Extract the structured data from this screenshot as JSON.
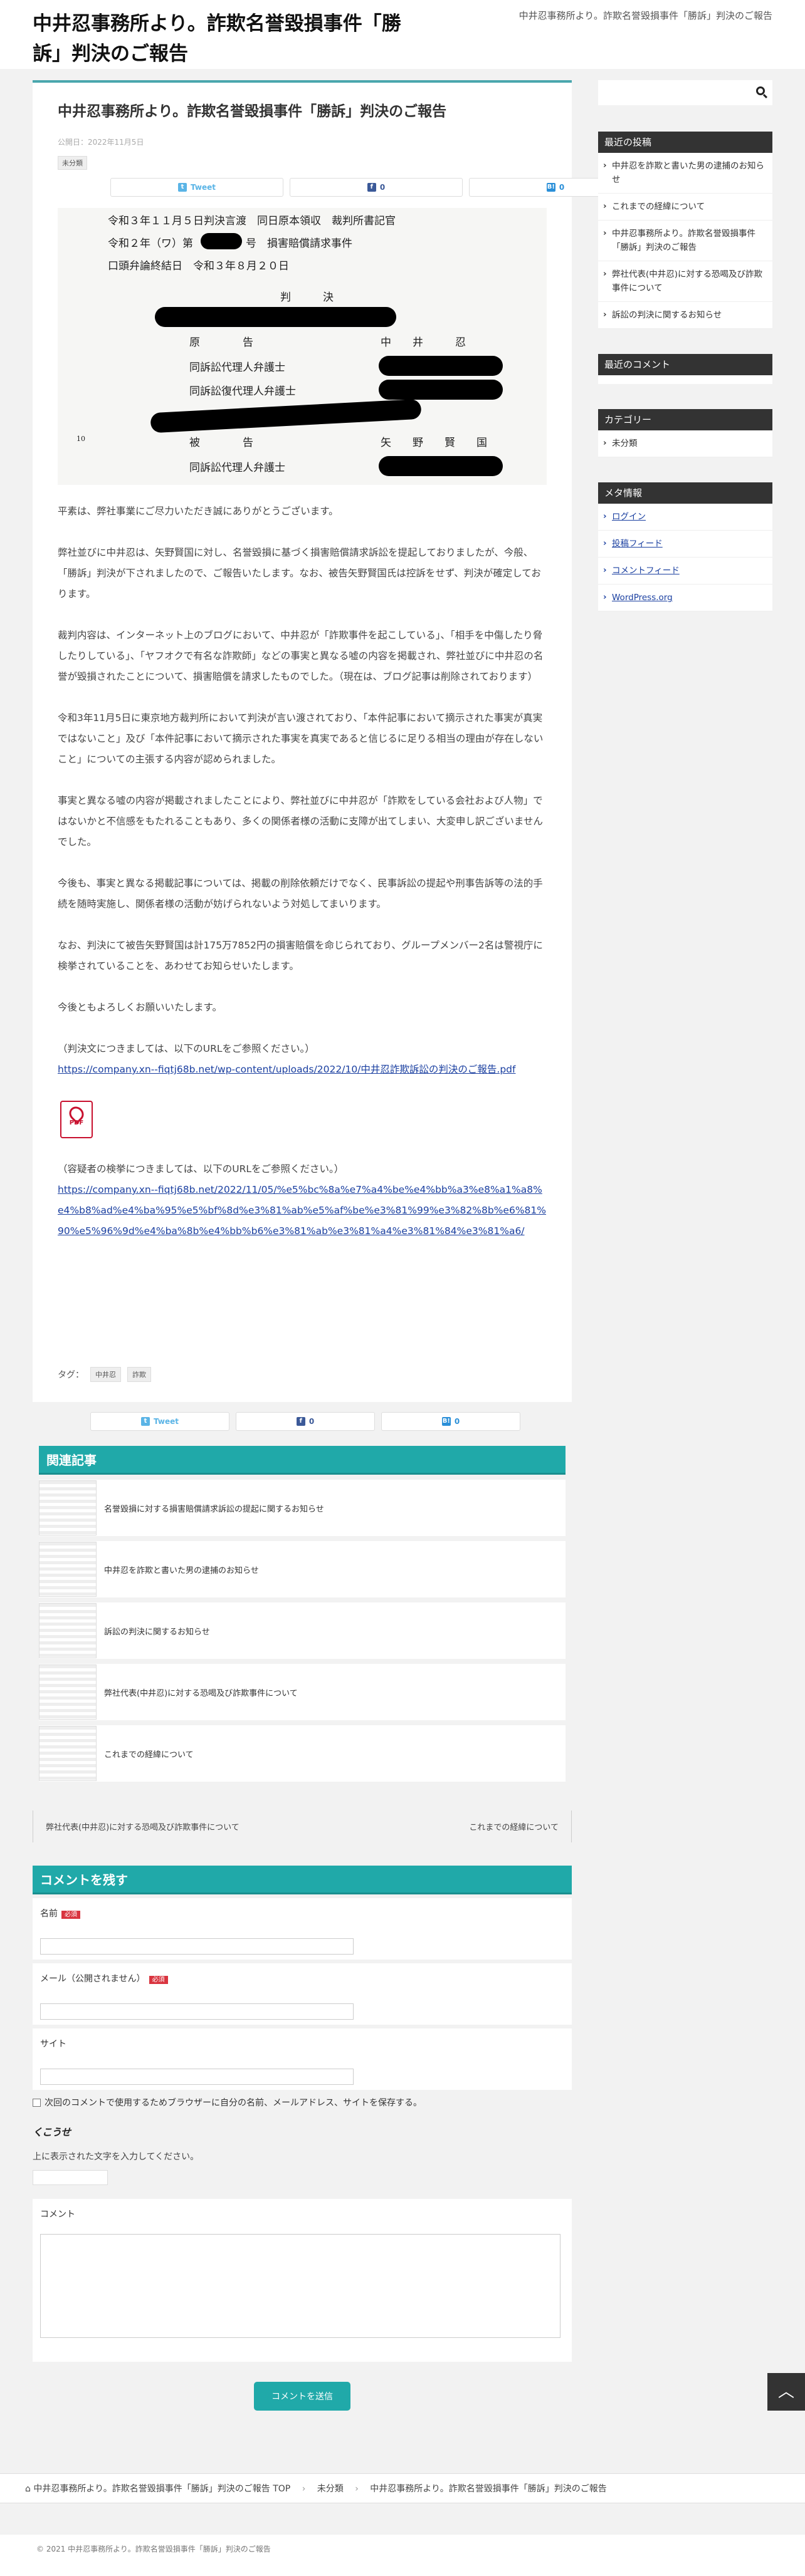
{
  "header": {
    "site_title": "中井忍事務所より。詐欺名誉毀損事件「勝訴」判決のご報告",
    "site_desc": "中井忍事務所より。詐欺名誉毀損事件「勝訴」判決のご報告"
  },
  "post": {
    "title": "中井忍事務所より。詐欺名誉毀損事件「勝訴」判決のご報告",
    "date": "公開日：2022年11月5日",
    "category": "未分類",
    "share": {
      "tweet": "Tweet",
      "fb": "0",
      "hatena": "0"
    },
    "document": {
      "line1": "令和３年１１月５日判決言渡　同日原本領収　裁判所書記官",
      "line2a": "令和２年（ワ）第",
      "line2b": "号　損害賠償請求事件",
      "line3": "口頭弁論終結日　令和３年８月２０日",
      "hanketsu": "判　　　決",
      "genkoku": "原　　　　告",
      "genkoku_name": "中　　井　　　忍",
      "dairi1": "同訴訟代理人弁護士",
      "fukudairi": "同訴訟復代理人弁護士",
      "hikoku": "被　　　　告",
      "hikoku_name": "矢　　野　　賢　　国",
      "dairi2": "同訴訟代理人弁護士",
      "line_no_10": "10"
    },
    "paragraphs": [
      "平素は、弊社事業にご尽力いただき誠にありがとうございます。",
      "弊社並びに中井忍は、矢野賢国に対し、名誉毀損に基づく損害賠償請求訴訟を提起しておりましたが、今般、「勝訴」判決が下されましたので、ご報告いたします。なお、被告矢野賢国氏は控訴をせず、判決が確定しております。",
      "裁判内容は、インターネット上のブログにおいて、中井忍が「詐欺事件を起こしている」、「相手を中傷したり脅したりしている」、「ヤフオクで有名な詐欺師」などの事実と異なる嘘の内容を掲載され、弊社並びに中井忍の名誉が毀損されたことについて、損害賠償を請求したものでした。（現在は、ブログ記事は削除されております）",
      "令和3年11月5日に東京地方裁判所において判決が言い渡されており、「本件記事において摘示された事実が真実ではないこと」及び「本件記事において摘示された事実を真実であると信じるに足りる相当の理由が存在しないこと」についての主張する内容が認められました。",
      "事実と異なる嘘の内容が掲載されましたことにより、弊社並びに中井忍が「詐欺をしている会社および人物」ではないかと不信感をもたれることもあり、多くの関係者様の活動に支障が出てしまい、大変申し訳ございませんでした。",
      "今後も、事実と異なる掲載記事については、掲載の削除依頼だけでなく、民事訴訟の提起や刑事告訴等の法的手続を随時実施し、関係者様の活動が妨げられないよう対処してまいります。",
      "なお、判決にて被告矢野賢国は計175万7852円の損害賠償を命じられており、グループメンバー2名は警視庁に検挙されていることを、あわせてお知らせいたします。",
      "今後ともよろしくお願いいたします。"
    ],
    "ruling_note": "（判決文につきましては、以下のURLをご参照ください。）",
    "ruling_link": "https://company.xn--fiqtj68b.net/wp-content/uploads/2022/10/中井忍詐欺訴訟の判決のご報告.pdf",
    "pdf_label": "PDF",
    "arrest_note": "（容疑者の検挙につきましては、以下のURLをご参照ください。）",
    "arrest_link": "https://company.xn--fiqtj68b.net/2022/11/05/%e5%bc%8a%e7%a4%be%e4%bb%a3%e8%a1%a8%e4%b8%ad%e4%ba%95%e5%bf%8d%e3%81%ab%e5%af%be%e3%81%99%e3%82%8b%e6%81%90%e5%96%9d%e4%ba%8b%e4%bb%b6%e3%81%ab%e3%81%a4%e3%81%84%e3%81%a6/",
    "tags_label": "タグ：",
    "tags": [
      "中井忍",
      "詐欺"
    ]
  },
  "related": {
    "heading": "関連記事",
    "items": [
      "名誉毀損に対する損害賠償請求訴訟の提起に関するお知らせ",
      "中井忍を詐欺と書いた男の逮捕のお知らせ",
      "訴訟の判決に関するお知らせ",
      "弊社代表(中井忍)に対する恐喝及び詐欺事件について",
      "これまでの経緯について"
    ]
  },
  "pager": {
    "prev": "弊社代表(中井忍)に対する恐喝及び詐欺事件について",
    "next": "これまでの経緯について"
  },
  "comment_form": {
    "heading": "コメントを残す",
    "name_label": "名前",
    "email_label": "メール（公開されません）",
    "required": "必須",
    "site_label": "サイト",
    "save_label": "次回のコメントで使用するためブラウザーに自分の名前、メールアドレス、サイトを保存する。",
    "captcha_text": "くこうせ",
    "captcha_label": "上に表示された文字を入力してください。",
    "comment_label": "コメント",
    "submit_label": "コメントを送信"
  },
  "sidebar": {
    "recent_posts_heading": "最近の投稿",
    "recent_posts": [
      "中井忍を詐欺と書いた男の逮捕のお知らせ",
      "これまでの経緯について",
      "中井忍事務所より。詐欺名誉毀損事件「勝訴」判決のご報告",
      "弊社代表(中井忍)に対する恐喝及び詐欺事件について",
      "訴訟の判決に関するお知らせ"
    ],
    "recent_comments_heading": "最近のコメント",
    "categories_heading": "カテゴリー",
    "categories": [
      "未分類"
    ],
    "meta_heading": "メタ情報",
    "meta": [
      "ログイン",
      "投稿フィード",
      "コメントフィード",
      "WordPress.org"
    ]
  },
  "breadcrumb": {
    "home": "中井忍事務所より。詐欺名誉毀損事件「勝訴」判決のご報告 TOP",
    "category": "未分類",
    "current": "中井忍事務所より。詐欺名誉毀損事件「勝訴」判決のご報告"
  },
  "footer": {
    "copyright": "© 2021 中井忍事務所より。詐欺名誉毀損事件「勝訴」判決のご報告"
  }
}
